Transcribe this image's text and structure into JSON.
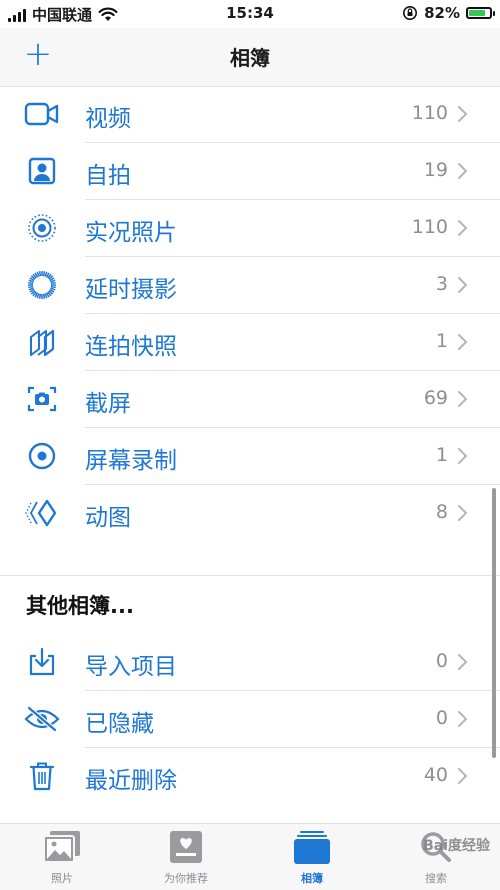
{
  "status_bar": {
    "carrier": "中国联通",
    "time": "15:34",
    "battery": "82%",
    "battery_level": 0.82
  },
  "nav": {
    "title": "相簿",
    "add_symbol": "+"
  },
  "media_types": [
    {
      "label": "视频",
      "count": "110",
      "icon": "video-icon"
    },
    {
      "label": "自拍",
      "count": "19",
      "icon": "selfie-icon"
    },
    {
      "label": "实况照片",
      "count": "110",
      "icon": "live-photo-icon"
    },
    {
      "label": "延时摄影",
      "count": "3",
      "icon": "timelapse-icon"
    },
    {
      "label": "连拍快照",
      "count": "1",
      "icon": "burst-icon"
    },
    {
      "label": "截屏",
      "count": "69",
      "icon": "screenshot-icon"
    },
    {
      "label": "屏幕录制",
      "count": "1",
      "icon": "screen-recording-icon"
    },
    {
      "label": "动图",
      "count": "8",
      "icon": "animated-icon"
    }
  ],
  "other_albums": {
    "title": "其他相簿...",
    "items": [
      {
        "label": "导入项目",
        "count": "0",
        "icon": "import-icon"
      },
      {
        "label": "已隐藏",
        "count": "0",
        "icon": "hidden-icon"
      },
      {
        "label": "最近删除",
        "count": "40",
        "icon": "trash-icon"
      }
    ]
  },
  "tabs": [
    {
      "label": "照片",
      "icon": "photos-icon"
    },
    {
      "label": "为你推荐",
      "icon": "for-you-icon"
    },
    {
      "label": "相簿",
      "icon": "albums-icon",
      "active": true
    },
    {
      "label": "搜索",
      "icon": "search-icon"
    }
  ],
  "watermark": "Bai度经验",
  "colors": {
    "accent": "#1e77d3",
    "count_gray": "#8e8e93",
    "battery_green": "#34c759"
  }
}
